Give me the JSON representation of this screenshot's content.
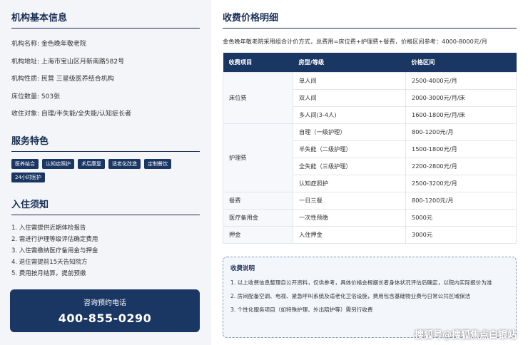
{
  "left": {
    "basic_title": "机构基本信息",
    "info": [
      {
        "label": "机构名称:",
        "value": "金色晚年敬老院"
      },
      {
        "label": "机构地址:",
        "value": "上海市宝山区月新南路582号"
      },
      {
        "label": "机构性质:",
        "value": "民营 三星级医养结合机构"
      },
      {
        "label": "床位数量:",
        "value": "503张"
      },
      {
        "label": "收住对象:",
        "value": "自理/半失能/全失能/认知症长者"
      }
    ],
    "features_title": "服务特色",
    "tags": [
      "医养结合",
      "认知症照护",
      "术后康复",
      "适老化改造",
      "定制餐饮",
      "24小时医护"
    ],
    "admission_title": "入住须知",
    "steps": [
      "1. 入住需提供近期体检报告",
      "2. 需进行护理等级评估确定费用",
      "3. 入住需缴纳医疗备用金与押金",
      "4. 退住需提前15天告知院方",
      "5. 费用按月结算，提前预缴"
    ],
    "cta_label": "咨询预约电话",
    "cta_phone": "400-855-0290"
  },
  "right": {
    "title": "收费价格明细",
    "desc": "金色晚年敬老院采用组合计价方式，总费用=床位费+护理费+餐费，价格区间参考：4000-8000元/月",
    "headers": [
      "收费项目",
      "房型/等级",
      "价格区间"
    ],
    "rows": [
      {
        "cat": "床位费",
        "span": 3,
        "type": "单人间",
        "price": "2500-4000元/月"
      },
      {
        "type": "双人间",
        "price": "2000-3000元/月/床"
      },
      {
        "type": "多人间(3-4人)",
        "price": "1600-1800元/月/床"
      },
      {
        "cat": "护理费",
        "span": 4,
        "type": "自理（一级护理）",
        "price": "800-1200元/月"
      },
      {
        "type": "半失能（二级护理）",
        "price": "1500-1800元/月"
      },
      {
        "type": "全失能（三级护理）",
        "price": "2200-2800元/月"
      },
      {
        "type": "认知症照护",
        "price": "2500-3200元/月"
      },
      {
        "cat": "餐费",
        "span": 1,
        "type": "一日三餐",
        "price": "800-1200元/月"
      },
      {
        "cat": "医疗备用金",
        "span": 1,
        "type": "一次性预缴",
        "price": "5000元"
      },
      {
        "cat": "押金",
        "span": 1,
        "type": "入住押金",
        "price": "3000元"
      }
    ],
    "note_title": "收费说明",
    "notes": [
      "1. 以上收费信息整理自公开资料，仅供参考，具体价格会根据长者身体状况评估后确定，以院内实际报价为准",
      "2. 房间配备空调、电视、紧急呼叫系统及适老化卫浴设施，费用包含基础物业费与日常公共区域保洁",
      "3. 个性化服务项目（如特殊护理、外出陪护等）需另行收费"
    ]
  },
  "watermark": "搜狐号@搜狐焦点白银站"
}
